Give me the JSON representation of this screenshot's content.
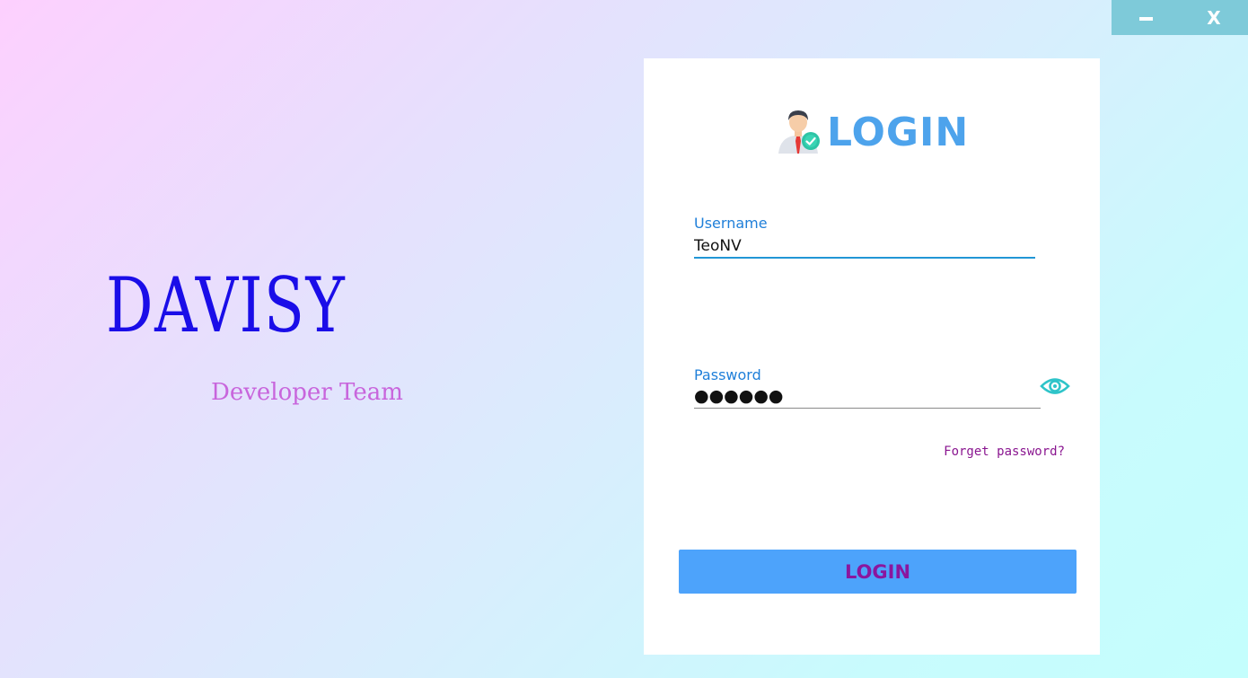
{
  "window": {
    "minimize_icon": "minus-icon",
    "close_label": "X"
  },
  "brand": {
    "title": "DAVISY",
    "subtitle": "Developer Team",
    "title_color": "#1a0de8",
    "subtitle_color": "#c865dc"
  },
  "login_card": {
    "title": "LOGIN",
    "title_icon": "verified-user-icon",
    "title_color": "#4da3ec",
    "username": {
      "label": "Username",
      "value": "TeoNV"
    },
    "password": {
      "label": "Password",
      "masked_value": "●●●●●●",
      "toggle_icon": "eye-icon"
    },
    "forgot_password": "Forget password?",
    "submit_label": "LOGIN",
    "submit_color": "#4da3fb"
  }
}
